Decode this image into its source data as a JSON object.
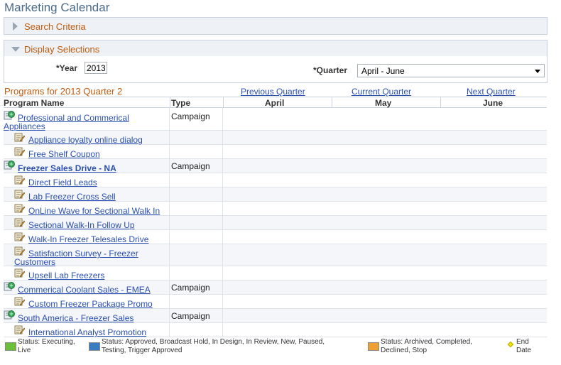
{
  "page_title": "Marketing Calendar",
  "search_criteria": "Search Criteria",
  "display_selections": "Display Selections",
  "year": {
    "label": "*Year",
    "value": "2013"
  },
  "quarter": {
    "label": "*Quarter",
    "value": "April - June"
  },
  "programs_title": "Programs for 2013 Quarter 2",
  "nav": {
    "previous": "Previous Quarter",
    "current": "Current Quarter",
    "next": "Next Quarter"
  },
  "columns": {
    "program_name": "Program Name",
    "type": "Type",
    "months": [
      "April",
      "May",
      "June"
    ]
  },
  "rows": {
    "r1": {
      "name_line1": "Professional and Commerical",
      "name_line2": "Appliances",
      "type": "Campaign"
    },
    "r2": {
      "name": "Appliance loyalty online dialog"
    },
    "r3": {
      "name": "Free Shelf Coupon"
    },
    "r4": {
      "name": "Freezer Sales Drive - NA",
      "type": "Campaign"
    },
    "r5": {
      "name": "Direct Field Leads"
    },
    "r6": {
      "name": "Lab Freezer Cross Sell"
    },
    "r7": {
      "name": "OnLine Wave for Sectional Walk In"
    },
    "r8": {
      "name": "Sectional Walk-In Follow Up"
    },
    "r9": {
      "name": "Walk-In Freezer Telesales Drive"
    },
    "r10": {
      "name_line1": "Satisfaction Survey - Freezer",
      "name_line2": "Customers"
    },
    "r11": {
      "name": "Upsell Lab Freezers"
    },
    "r12": {
      "name": "Commerical Coolant Sales - EMEA",
      "type": "Campaign"
    },
    "r13": {
      "name": "Custom Freezer Package Promo"
    },
    "r14": {
      "name": "South America - Freezer Sales",
      "type": "Campaign"
    },
    "r15": {
      "name": "International Analyst Promotion"
    }
  },
  "legend": {
    "green": {
      "line1": "Status: Executing,",
      "line2": "Live",
      "color": "#6cbf3a"
    },
    "blue": {
      "line1": "Status: Approved, Broadcast Hold, In Design, In Review, New, Paused,",
      "line2": "Testing, Trigger Approved",
      "color": "#3a7cc4"
    },
    "orange": {
      "line1": "Status: Archived, Completed,",
      "line2": "Declined, Stop",
      "color": "#f0a030"
    },
    "end": {
      "line1": "End",
      "line2": "Date",
      "color": "#f2e600"
    }
  },
  "colors": {
    "link": "#2a4fb0",
    "section_title": "#c15a0d",
    "title": "#4a6a8a"
  }
}
